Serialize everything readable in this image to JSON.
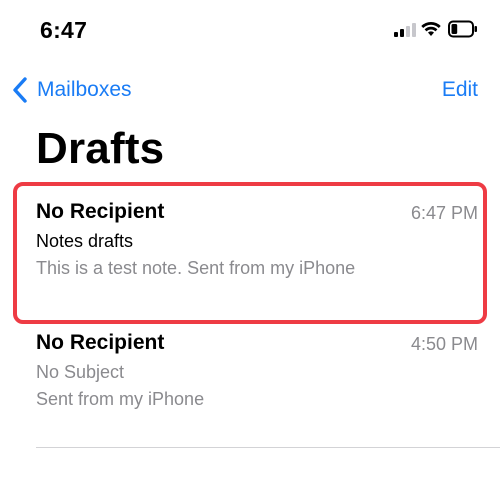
{
  "status_bar": {
    "time": "6:47",
    "battery_level": 0.3
  },
  "nav": {
    "back_label": "Mailboxes",
    "edit_label": "Edit"
  },
  "page": {
    "title": "Drafts"
  },
  "messages": [
    {
      "sender": "No Recipient",
      "time": "6:47 PM",
      "subject": "Notes drafts",
      "preview": "This is a test note. Sent from my iPhone",
      "highlighted": true
    },
    {
      "sender": "No Recipient",
      "time": "4:50 PM",
      "subject": "No Subject",
      "preview": "Sent from my iPhone",
      "highlighted": false
    }
  ],
  "colors": {
    "accent": "#1a7cf5",
    "highlight": "#ee3b44",
    "secondary_text": "#8a8a8e"
  }
}
